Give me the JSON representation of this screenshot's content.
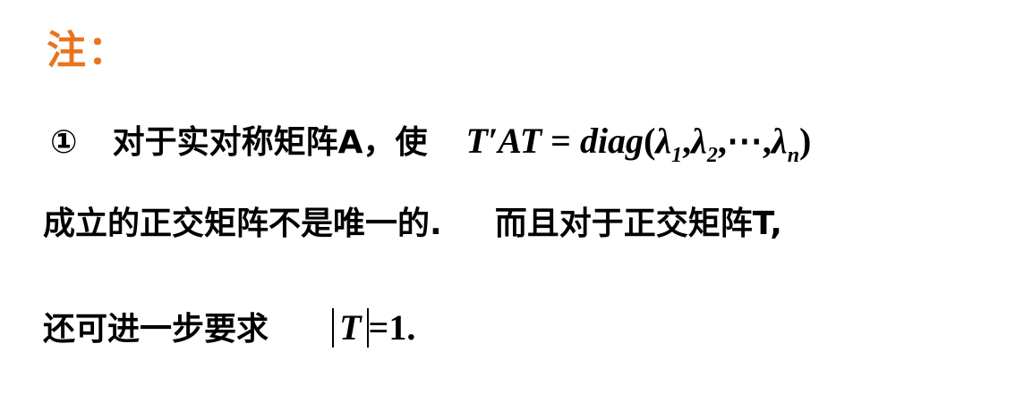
{
  "note_title": "注：",
  "line1": {
    "marker": "①",
    "text": "对于实对称矩阵A，使",
    "math_lhs": "T′AT",
    "equals": "=",
    "func": "diag",
    "open_paren": "(",
    "lambda": "λ",
    "sub1": "1",
    "sub2": "2",
    "sep": ",",
    "dots": "⋯",
    "subn": "n",
    "close_paren": ")"
  },
  "line2": {
    "text_a": "成立的正交矩阵不是唯一的.",
    "text_b": "而且对于正交矩阵T,"
  },
  "line3": {
    "text": "还可进一步要求",
    "det_var": "T",
    "equals": "=",
    "value": "1."
  }
}
